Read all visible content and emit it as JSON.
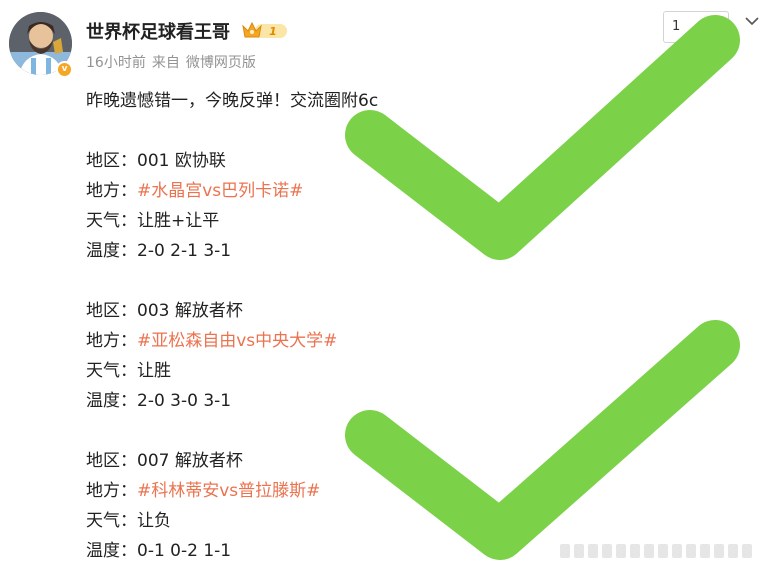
{
  "header": {
    "username": "世界杯足球看王哥",
    "vip_level": "1",
    "verify_mark": "v",
    "meta": {
      "time": "16小时前",
      "source_prefix": "来自",
      "source": "微博网页版"
    },
    "follow_button": "1",
    "colors": {
      "verify": "#f5a623",
      "vip": "#f5a623",
      "topic": "#eb7350",
      "check": "#7bd148"
    }
  },
  "post": {
    "intro": "昨晚遗憾错一，今晚反弹！交流圈附6c",
    "blocks": [
      {
        "region_label": "地区：",
        "region": "001  欧协联",
        "side_label": "地方：",
        "match": "#水晶宫vs巴列卡诺#",
        "weather_label": "天气：",
        "pick": "让胜+让平",
        "temp_label": "温度：",
        "scores": "2-0  2-1  3-1"
      },
      {
        "region_label": "地区：",
        "region": "003  解放者杯",
        "side_label": "地方：",
        "match": "#亚松森自由vs中央大学#",
        "weather_label": "天气：",
        "pick": "让胜",
        "temp_label": "温度：",
        "scores": "2-0  3-0  3-1"
      },
      {
        "region_label": "地区：",
        "region": "007  解放者杯",
        "side_label": "地方：",
        "match": "#科林蒂安vs普拉滕斯#",
        "weather_label": "天气：",
        "pick": "让负",
        "temp_label": "温度：",
        "scores": "0-1  0-2  1-1"
      }
    ]
  },
  "icons": {
    "avatar": "user-avatar",
    "vip": "crown-icon",
    "dropdown": "chevron-down-icon",
    "overlay": "green-checkmark"
  }
}
